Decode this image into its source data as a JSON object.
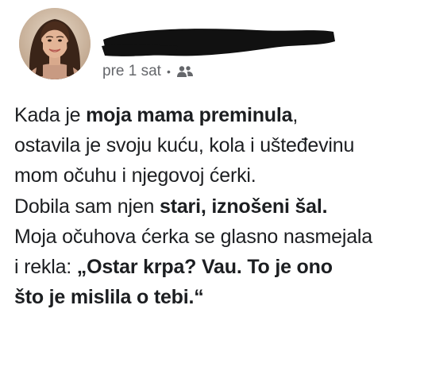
{
  "post": {
    "timestamp": "pre 1 sat",
    "separator": "•",
    "audience_icon": "friends-icon",
    "paragraph1": {
      "l1a": "Kada je ",
      "l1b": "moja mama preminula",
      "l1c": ",",
      "l2": "ostavila je svoju kuću, kola i ušteđevinu",
      "l3": "mom očuhu i njegovoj ćerki."
    },
    "paragraph2": {
      "l1a": "Dobila sam njen ",
      "l1b": "stari, iznošeni šal.",
      "l2": "Moja očuhova ćerka se glasno nasmejala",
      "l3a": "i rekla: ",
      "l3b": "„Ostar krpa? Vau. To je ono",
      "l4": "što je mislila o tebi.“"
    }
  },
  "colors": {
    "text": "#1c1e21",
    "meta": "#65676b",
    "redaction": "#111111"
  }
}
